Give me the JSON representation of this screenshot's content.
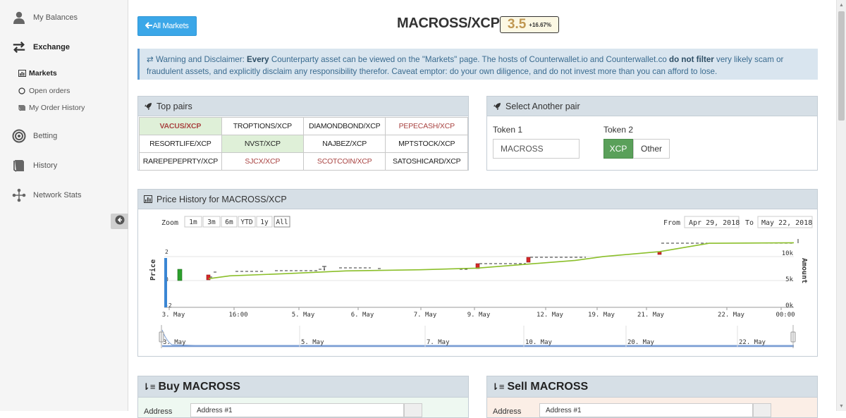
{
  "sidebar": {
    "items": [
      {
        "label": "My Balances",
        "icon": "user-icon"
      },
      {
        "label": "Exchange",
        "icon": "exchange-icon",
        "active": true
      },
      {
        "label": "Betting",
        "icon": "target-icon"
      },
      {
        "label": "History",
        "icon": "book-icon"
      },
      {
        "label": "Network Stats",
        "icon": "network-icon"
      }
    ],
    "subitems": [
      {
        "label": "Markets",
        "icon": "bar-chart-icon",
        "active": true
      },
      {
        "label": "Open orders",
        "icon": "circle-icon"
      },
      {
        "label": "My Order History",
        "icon": "book-icon"
      }
    ]
  },
  "header": {
    "all_markets_label": "All Markets",
    "pair": "MACROSS/XCP",
    "price": "3.5",
    "change": "+16.67%"
  },
  "disclaimer": {
    "p1": " Warning and Disclaimer: ",
    "b1": "Every",
    "p2": " Counterparty asset can be viewed on the \"Markets\" page. The hosts of Counterwallet.io and Counterwallet.co ",
    "b2": "do not filter",
    "p3": " very likely scam or fraudulent assets, and explicitly disclaim any responsibility therefor. Caveat emptor: do your own diligence, and do not invest more than you can afford to lose."
  },
  "top_pairs": {
    "title": "Top pairs",
    "rows": [
      [
        {
          "t": "VACUS/XCP",
          "s": "bold pos"
        },
        {
          "t": "TROPTIONS/XCP",
          "s": ""
        },
        {
          "t": "DIAMONDBOND/XCP",
          "s": ""
        },
        {
          "t": "PEPECASH/XCP",
          "s": "neg"
        }
      ],
      [
        {
          "t": "RESORTLIFE/XCP",
          "s": ""
        },
        {
          "t": "NVST/XCP",
          "s": "pos"
        },
        {
          "t": "NAJBEZ/XCP",
          "s": ""
        },
        {
          "t": "MPTSTOCK/XCP",
          "s": ""
        }
      ],
      [
        {
          "t": "RAREPEPEPRTY/XCP",
          "s": ""
        },
        {
          "t": "SJCX/XCP",
          "s": "neg"
        },
        {
          "t": "SCOTCOIN/XCP",
          "s": "neg"
        },
        {
          "t": "SATOSHICARD/XCP",
          "s": ""
        }
      ]
    ]
  },
  "select_pair": {
    "title": "Select Another pair",
    "token1_label": "Token 1",
    "token2_label": "Token 2",
    "token1_value": "MACROSS",
    "xcp_label": "XCP",
    "other_label": "Other"
  },
  "price_history": {
    "title": "Price History for MACROSS/XCP",
    "zoom_label": "Zoom",
    "zoom_options": [
      "1m",
      "3m",
      "6m",
      "YTD",
      "1y",
      "All"
    ],
    "from_label": "From",
    "from_date": "Apr 29, 2018",
    "to_label": "To",
    "to_date": "May 22, 2018"
  },
  "chart_data": {
    "type": "line",
    "ylabel_left": "Price",
    "ylabel_right": "Amount",
    "y_left_ticks": [
      "2",
      "0",
      "-2"
    ],
    "y_right_ticks": [
      "10k",
      "5k",
      "0k"
    ],
    "x_ticks": [
      "3. May",
      "16:00",
      "5. May",
      "6. May",
      "7. May",
      "9. May",
      "12. May",
      "19. May",
      "21. May",
      "22. May",
      "00:00"
    ],
    "navigator_ticks": [
      "3. May",
      "5. May",
      "7. May",
      "10. May",
      "20. May",
      "22. May"
    ],
    "amount_line": [
      {
        "x": "3. May",
        "y": 5200
      },
      {
        "x": "16:00",
        "y": 5700
      },
      {
        "x": "5. May",
        "y": 6100
      },
      {
        "x": "6. May",
        "y": 6600
      },
      {
        "x": "7. May",
        "y": 6800
      },
      {
        "x": "9. May",
        "y": 7100
      },
      {
        "x": "12. May",
        "y": 8500
      },
      {
        "x": "19. May",
        "y": 9200
      },
      {
        "x": "21. May",
        "y": 10100
      },
      {
        "x": "22. May",
        "y": 11600
      },
      {
        "x": "00:00",
        "y": 11700
      }
    ],
    "colors": {
      "amount_line": "#8bbf2a",
      "up": "#2ca02c",
      "down": "#d62728",
      "price_axis": "#a94442",
      "amount_axis": "#3a5fa8"
    }
  },
  "buy": {
    "title": "Buy MACROSS",
    "address_label": "Address",
    "address_value": "Address #1"
  },
  "sell": {
    "title": "Sell MACROSS",
    "address_label": "Address",
    "address_value": "Address #1"
  }
}
